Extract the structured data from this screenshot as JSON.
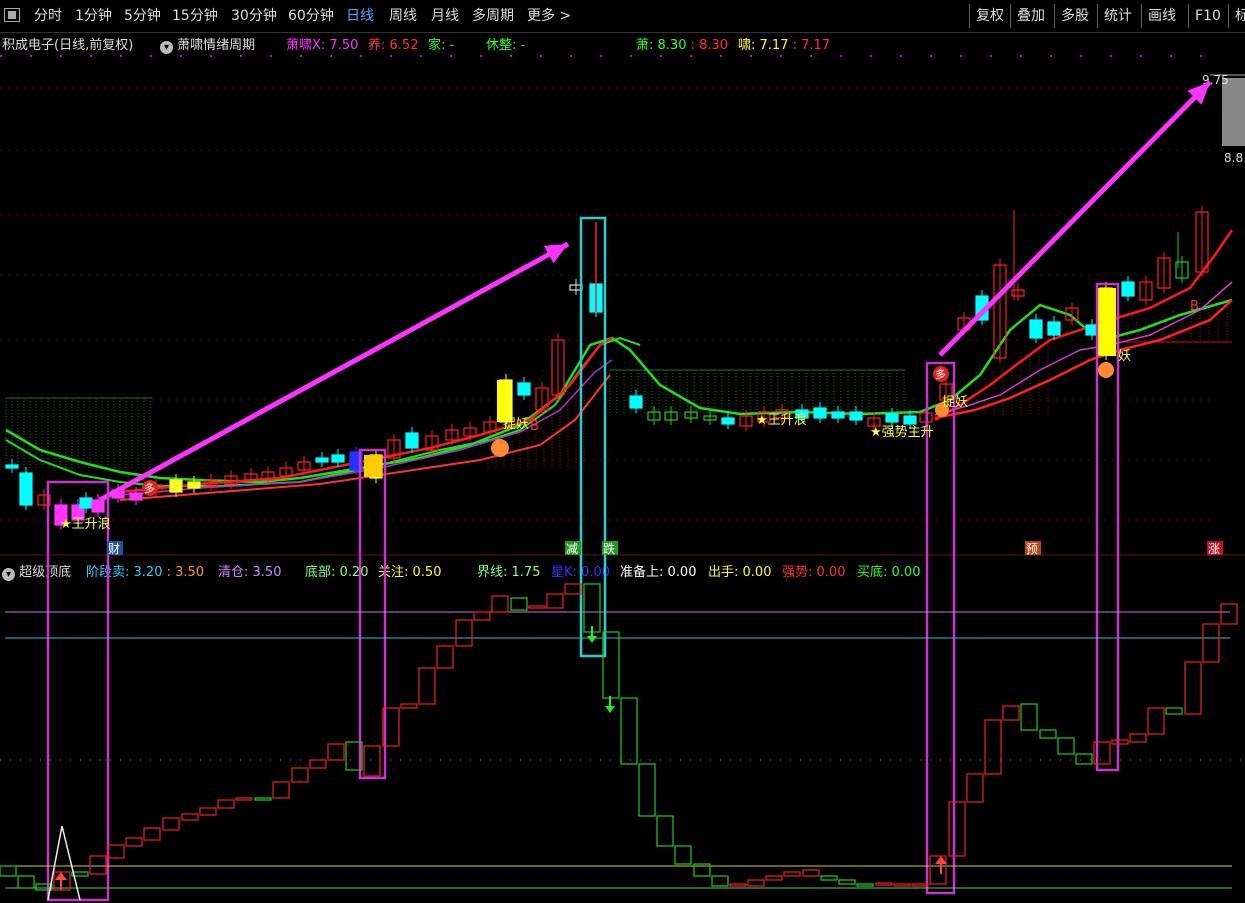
{
  "toolbar": {
    "periods": [
      "分时",
      "1分钟",
      "5分钟",
      "15分钟",
      "30分钟",
      "60分钟",
      "日线",
      "周线",
      "月线",
      "多周期",
      "更多 >"
    ],
    "active": "日线",
    "right": [
      "复权",
      "叠加",
      "多股",
      "统计",
      "画线",
      "F10",
      "标"
    ]
  },
  "main_info": {
    "title": "积成电子(日线,前复权)",
    "indicator": "萧啸情绪周期",
    "items": [
      {
        "label": "萧啸X:",
        "value": "7.50",
        "color": "#ff33ff"
      },
      {
        "label": "养:",
        "value": "6.52",
        "color": "#ff3333"
      },
      {
        "label": "家:",
        "value": "-",
        "color": "#33ff33"
      },
      {
        "label": "休整:",
        "value": "-",
        "color": "#33ff33"
      },
      {
        "label": "萧:",
        "value": "8.30",
        "extra": ": 8.30",
        "color": "#33ff33",
        "extra_color": "#ff3333"
      },
      {
        "label": "啸:",
        "value": "7.17",
        "extra": ": 7.17",
        "color": "#ffff33",
        "extra_color": "#ff3333"
      }
    ]
  },
  "price_axis": {
    "top": "9.75",
    "bottom": "8.8"
  },
  "labels": {
    "wang_sheng": "★王升浪",
    "zhuo_yao_1": "捉妖",
    "zhuo_yao_2": "捉妖",
    "zhuo_yao_3": "妖",
    "wang_sheng_2": "★王升浪",
    "qiang_shi": "★强势主升",
    "duo": "多",
    "cai": "财",
    "jian": "减",
    "die": "跌",
    "yu": "预",
    "zhang": "涨",
    "b": "B"
  },
  "sub_info": {
    "title": "超级顶底",
    "items": [
      {
        "label": "阶段卖:",
        "value": "3.20",
        "extra": ": 3.50",
        "color": "#33ccff",
        "extra_color": "#ff9933"
      },
      {
        "label": "清仓:",
        "value": "3.50",
        "color": "#cc88ff"
      },
      {
        "label": "底部:",
        "value": "0.20",
        "color": "#88ff88"
      },
      {
        "label": "关注:",
        "value": "0.50",
        "color": "#ffff33"
      },
      {
        "label": "界线:",
        "value": "1.75",
        "color": "#88ff88"
      },
      {
        "label": "星K:",
        "value": "0.00",
        "color": "#3333ff"
      },
      {
        "label": "准备上:",
        "value": "0.00",
        "color": "#ffffff"
      },
      {
        "label": "出手:",
        "value": "0.00",
        "color": "#ffff33"
      },
      {
        "label": "强势:",
        "value": "0.00",
        "color": "#ff3333"
      },
      {
        "label": "买底:",
        "value": "0.00",
        "color": "#33ff33"
      }
    ]
  },
  "colors": {
    "up": "#ff2020",
    "down": "#00ffff",
    "ma_green": "#22dd22",
    "arrow": "#ff33ff",
    "box": "#cc33cc",
    "box2": "#33cccc"
  }
}
